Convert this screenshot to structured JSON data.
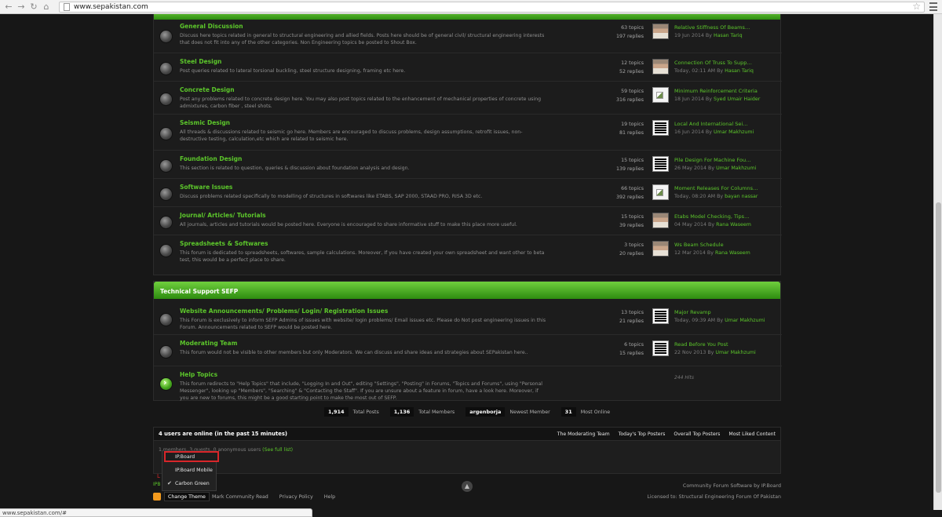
{
  "browser": {
    "url": "www.sepakistan.com",
    "status_url": "www.sepakistan.com/#"
  },
  "categories": [
    {
      "title": "",
      "forums": [
        {
          "title": "General Discussion",
          "description": "Discuss here topics related in general to structural engineering and allied fields. Posts here should be of general civil/ structural engineering interests that does not fit into any of the other categories. Non Engineering topics be posted to Shout Box.",
          "topics": "63 topics",
          "replies": "197 replies",
          "last_title": "Relative Stiffness Of Beams…",
          "last_date": "19 Jun 2014 By",
          "last_by": "Hasan Tariq",
          "avatar": "photo"
        },
        {
          "title": "Steel Design",
          "description": "Post queries related to lateral torsional buckling, steel structure designing, framing etc here.",
          "topics": "12 topics",
          "replies": "52 replies",
          "last_title": "Connection Of Truss To Supp…",
          "last_date": "Today, 02:11 AM By",
          "last_by": "Hasan Tariq",
          "avatar": "photo"
        },
        {
          "title": "Concrete Design",
          "description": "Post any problems related to concrete design here. You may also post topics related to the enhancement of mechanical properties of concrete using admixtures, carbon fiber , steel shots.",
          "topics": "59 topics",
          "replies": "316 replies",
          "last_title": "Minimum Reinforcement Criteria",
          "last_date": "18 Jun 2014 By",
          "last_by": "Syed Umair Haider",
          "avatar": "broken"
        },
        {
          "title": "Seismic Design",
          "description": "All threads & discussions related to seismic go here. Members are encouraged to discuss problems, design assumptions, retrofit issues, non-destructive testing, calculation,etc which are related to seismic here.",
          "topics": "19 topics",
          "replies": "81 replies",
          "last_title": "Local And International Sei…",
          "last_date": "16 Jun 2014 By",
          "last_by": "Umar Makhzumi",
          "avatar": "logo"
        },
        {
          "title": "Foundation Design",
          "description": "This section is related to question, queries & discussion about foundation analysis and design.",
          "topics": "15 topics",
          "replies": "139 replies",
          "last_title": "Pile Design For Machine Fou…",
          "last_date": "26 May 2014 By",
          "last_by": "Umar Makhzumi",
          "avatar": "logo"
        },
        {
          "title": "Software Issues",
          "description": "Discuss problems related specifically to modelling of structures in softwares like ETABS, SAP 2000, STAAD PRO, RISA 3D etc.",
          "topics": "66 topics",
          "replies": "392 replies",
          "last_title": "Moment Releases For Columns…",
          "last_date": "Today, 08:20 AM By",
          "last_by": "bayan nassar",
          "avatar": "broken"
        },
        {
          "title": "Journal/ Articles/ Tutorials",
          "description": "All journals, articles and tutorials would be posted here. Everyone is encouraged to share informative stuff to make this place more useful.",
          "topics": "15 topics",
          "replies": "39 replies",
          "last_title": "Etabs Model Checking, Tips…",
          "last_date": "04 May 2014 By",
          "last_by": "Rana Waseem",
          "avatar": "photo"
        },
        {
          "title": "Spreadsheets & Softwares",
          "description": "This forum is dedicated to spreadsheets, softwares, sample calculations. Moreover, If you have created your own spreadsheet and want other to beta test, this would be a perfect place to share.",
          "topics": "3 topics",
          "replies": "20 replies",
          "last_title": "Ws Beam Schedule",
          "last_date": "12 Mar 2014 By",
          "last_by": "Rana Waseem",
          "avatar": "photo"
        }
      ]
    },
    {
      "title": "Technical Support SEFP",
      "forums": [
        {
          "title": "Website Announcements/ Problems/ Login/ Registration Issues",
          "description": "This Forum is exclusively to inform SEFP Admins of issues with website/ login problems/ Email issues etc. Please do Not post engineering issues in this Forum. Announcements related to SEFP would be posted here.",
          "topics": "13 topics",
          "replies": "21 replies",
          "last_title": "Major Revamp",
          "last_date": "Today, 09:39 AM By",
          "last_by": "Umar Makhzumi",
          "avatar": "logo"
        },
        {
          "title": "Moderating Team",
          "description": "This forum would not be visible to other members but only Moderators. We can discuss and share ideas and strategies about SEPakistan here..",
          "topics": "6 topics",
          "replies": "15 replies",
          "last_title": "Read Before You Post",
          "last_date": "22 Nov 2013 By",
          "last_by": "Umar Makhzumi",
          "avatar": "logo"
        },
        {
          "title": "Help Topics",
          "description": "This forum redirects to \"Help Topics\" that include, \"Logging In and Out\", editing \"Settings\", \"Posting\" in Forums, \"Topics and Forums\", using \"Personal Messenger\", looking up \"Members\", \"Searching\" & \"Contacting the Staff\". If you are unsure about a feature in forum, have a look here. Moreover, if you are new to forums, this might be a good starting point to make the most out of SEFP.",
          "hits": "244 Hits"
        }
      ]
    }
  ],
  "totals": [
    {
      "value": "1,914",
      "label": "Total Posts"
    },
    {
      "value": "1,136",
      "label": "Total Members"
    },
    {
      "value": "argenborja",
      "label": "Newest Member"
    },
    {
      "value": "31",
      "label": "Most Online"
    }
  ],
  "online": {
    "title": "4 users are online (in the past 15 minutes)",
    "links": [
      "The Moderating Team",
      "Today's Top Posters",
      "Overall Top Posters",
      "Most Liked Content"
    ],
    "sub_text": "1 members, 3 guests, 0 anonymous users",
    "sub_link": "(See full list)"
  },
  "theme_menu": {
    "items": [
      "IP.Board",
      "IP.Board Mobile",
      "Carbon Green"
    ],
    "selected": "IP.Board",
    "checked": "Carbon Green"
  },
  "footer": {
    "ipb_text": "IPB",
    "change_theme": "Change Theme",
    "links": [
      "Mark Community Read",
      "Privacy Policy",
      "Help"
    ],
    "powered": "Community Forum Software by IP.Board",
    "licensed": "Licensed to: Structural Engineering Forum Of Pakistan"
  },
  "colors": {
    "accent_green": "#5cc62b",
    "header_green": "#3fa81c",
    "highlight_red": "#d8262a"
  }
}
